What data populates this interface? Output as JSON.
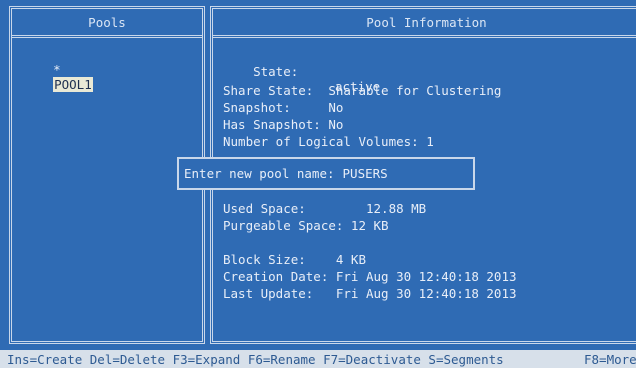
{
  "left_pane": {
    "title": "Pools",
    "items": [
      {
        "marker": "*",
        "name": "POOL1",
        "selected": true
      }
    ]
  },
  "right_pane": {
    "title": "Pool Information",
    "state_label": "State:",
    "state_value": "active",
    "share_state_line": "Share State:  Sharable for Clustering",
    "snapshot_line": "Snapshot:     No",
    "has_snapshot_line": "Has Snapshot: No",
    "logical_volumes_line": "Number of Logical Volumes: 1",
    "used_space_line": "Used Space:        12.88 MB",
    "purgeable_line": "Purgeable Space: 12 KB",
    "block_size_line": "Block Size:    4 KB",
    "creation_line": "Creation Date: Fri Aug 30 12:40:18 2013",
    "last_update_line": "Last Update:   Fri Aug 30 12:40:18 2013"
  },
  "dialog": {
    "prompt": "Enter new pool name:",
    "value": "PUSERS"
  },
  "status_bar": {
    "left_text": "Ins=Create Del=Delete F3=Expand F6=Rename F7=Deactivate S=Segments",
    "right_text": "F8=More"
  },
  "colors": {
    "background": "#2f6bb4",
    "status_bar": "#d7e0ea",
    "selection": "#e9e9d6"
  }
}
